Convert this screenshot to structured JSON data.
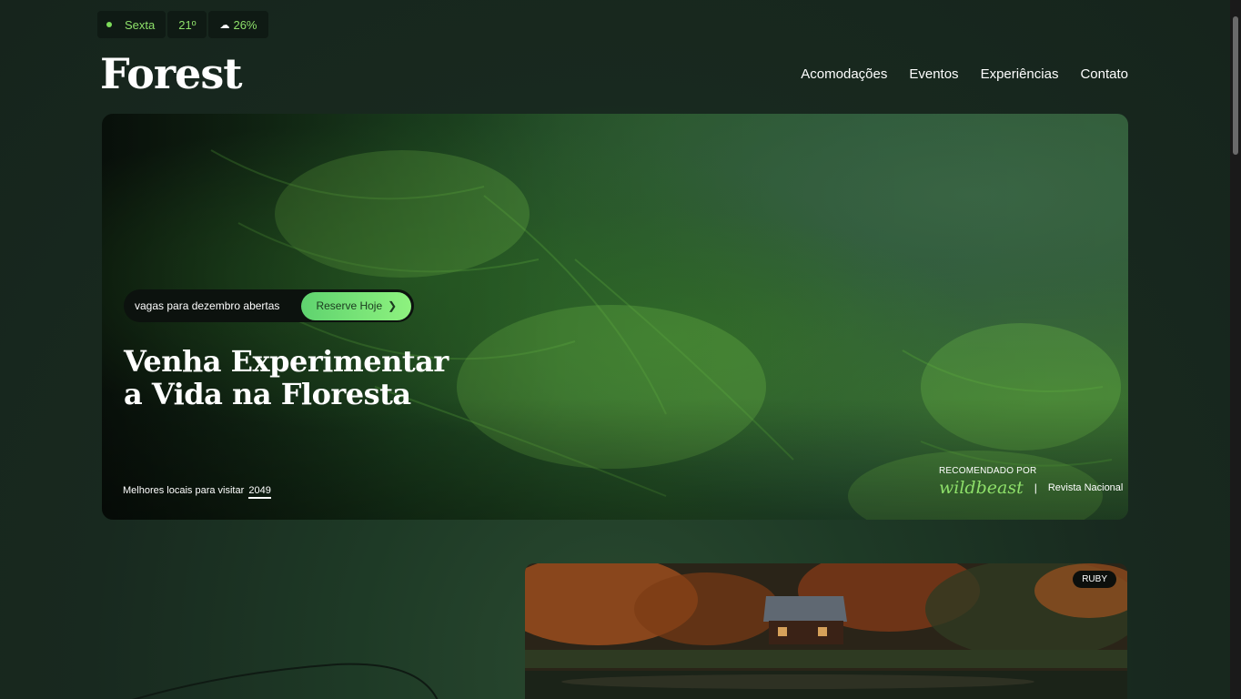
{
  "status": {
    "day": "Sexta",
    "temperature": "21º",
    "rain": "26%"
  },
  "header": {
    "logo": "Forest",
    "nav": [
      "Acomodações",
      "Eventos",
      "Experiências",
      "Contato"
    ]
  },
  "hero": {
    "booking_text": "vagas para dezembro abertas",
    "reserve_label": "Reserve Hoje",
    "title_line1": "Venha Experimentar",
    "title_line2": "a Vida na Floresta",
    "best_places_text": "Melhores locais para visitar",
    "best_places_year": "2049",
    "recommended_label": "RECOMENDADO POR",
    "recommended_brand": "wildbeast",
    "recommended_separator": "|",
    "recommended_magazine": "Revista Nacional"
  },
  "card": {
    "tag": "RUBY"
  },
  "colors": {
    "accent": "#8ee06a",
    "background": "#16251d"
  }
}
